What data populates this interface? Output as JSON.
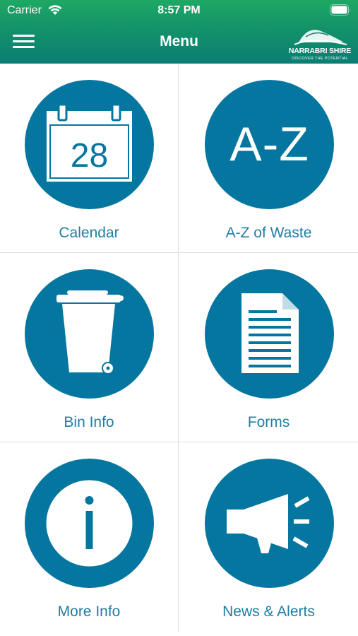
{
  "status_bar": {
    "carrier": "Carrier",
    "time": "8:57 PM"
  },
  "nav": {
    "title": "Menu",
    "menu_icon": "hamburger-icon"
  },
  "logo": {
    "name": "NARRABRI SHIRE",
    "tagline": "DISCOVER THE POTENTIAL"
  },
  "colors": {
    "accent": "#05769f",
    "label": "#1f7ea5",
    "header_top": "#1fa864",
    "header_bottom": "#0a7e74"
  },
  "tiles": [
    {
      "label": "Calendar",
      "icon": "calendar-icon",
      "day": "28"
    },
    {
      "label": "A-Z of Waste",
      "icon": "a-z-icon",
      "icon_text": "A-Z"
    },
    {
      "label": "Bin Info",
      "icon": "wheelie-bin-icon"
    },
    {
      "label": "Forms",
      "icon": "document-icon"
    },
    {
      "label": "More Info",
      "icon": "info-icon"
    },
    {
      "label": "News & Alerts",
      "icon": "megaphone-icon"
    }
  ]
}
